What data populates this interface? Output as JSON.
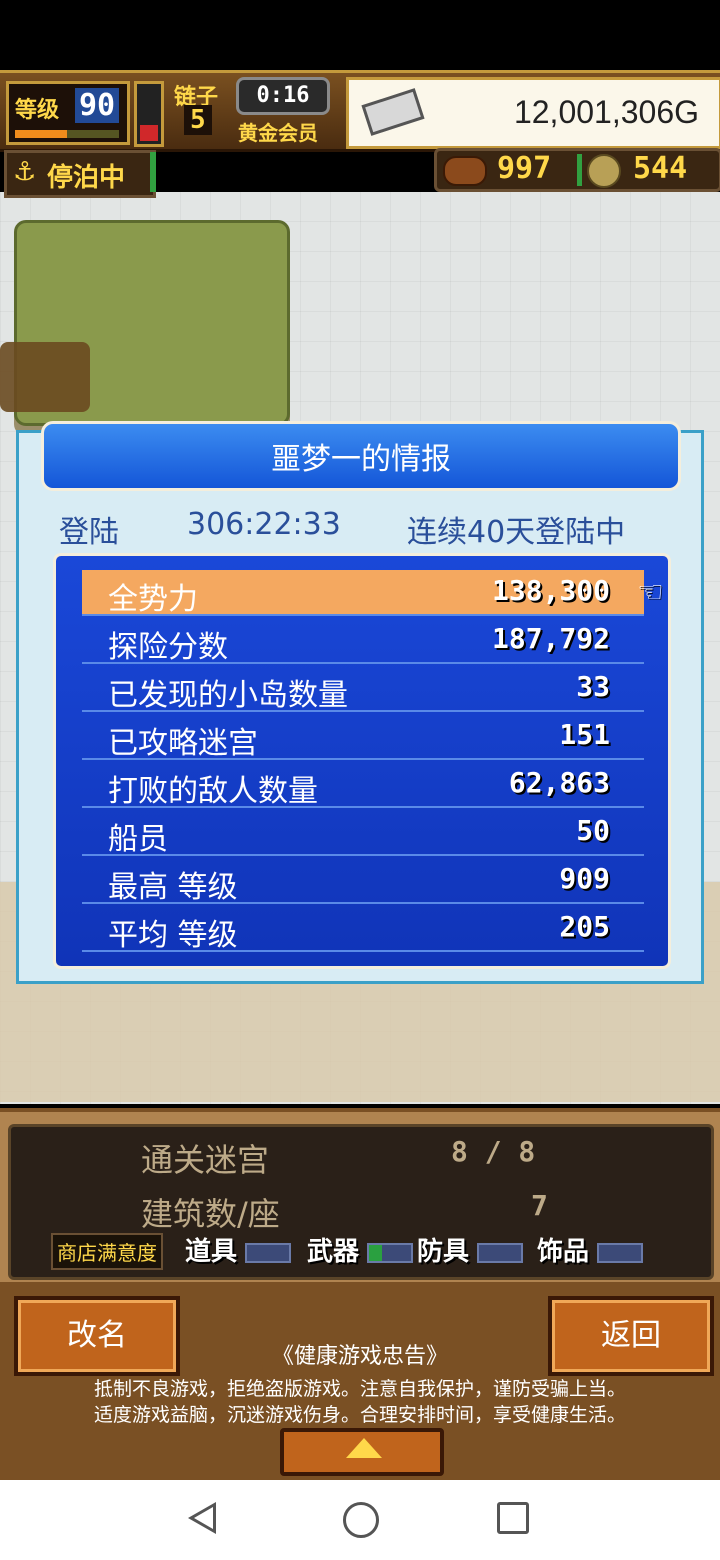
{
  "hud": {
    "level_label": "等级",
    "level_value": "90",
    "level_progress": 0.5,
    "hp_level": 0.3,
    "floor_label": "链子",
    "floor_value": "5",
    "timer": "0:16",
    "member": "黄金会员",
    "gold": "12,001,306G",
    "ticket_icon": "ticket-icon"
  },
  "status": {
    "anchor_icon": "⚓",
    "docked_label": "停泊中",
    "food_icon": "food-icon",
    "food_value": "997",
    "coin_icon": "coin-icon",
    "coin_value": "544"
  },
  "dialog": {
    "title": "噩梦一的情报",
    "login_label": "登陆",
    "login_time": "306:22:33",
    "login_streak": "连续40天登陆中",
    "stats": [
      {
        "label": "全势力",
        "value": "138,300"
      },
      {
        "label": "探险分数",
        "value": "187,792"
      },
      {
        "label": "已发现的小岛数量",
        "value": "33"
      },
      {
        "label": "已攻略迷宫",
        "value": "151"
      },
      {
        "label": "打败的敌人数量",
        "value": "62,863"
      },
      {
        "label": "船员",
        "value": "50"
      },
      {
        "label": "最高 等级",
        "value": "909"
      },
      {
        "label": "平均 等级",
        "value": "205"
      }
    ],
    "selected_index": 0,
    "cursor_icon": "☜"
  },
  "bottom": {
    "clear_label": "通关迷宫",
    "clear_value": "8 / 8",
    "build_label": "建筑数/座",
    "build_value": "7",
    "satisfaction_label": "商店满意度",
    "shop_items": [
      {
        "label": "道具",
        "level": 0
      },
      {
        "label": "武器",
        "level": 0.3
      },
      {
        "label": "防具",
        "level": 0
      },
      {
        "label": "饰品",
        "level": 0
      }
    ]
  },
  "footer": {
    "rename_label": "改名",
    "back_label": "返回",
    "notice_title": "《健康游戏忠告》",
    "notice_line1": "抵制不良游戏，拒绝盗版游戏。注意自我保护，谨防受骗上当。",
    "notice_line2": "适度游戏益脑，沉迷游戏伤身。合理安排时间，享受健康生活。"
  }
}
